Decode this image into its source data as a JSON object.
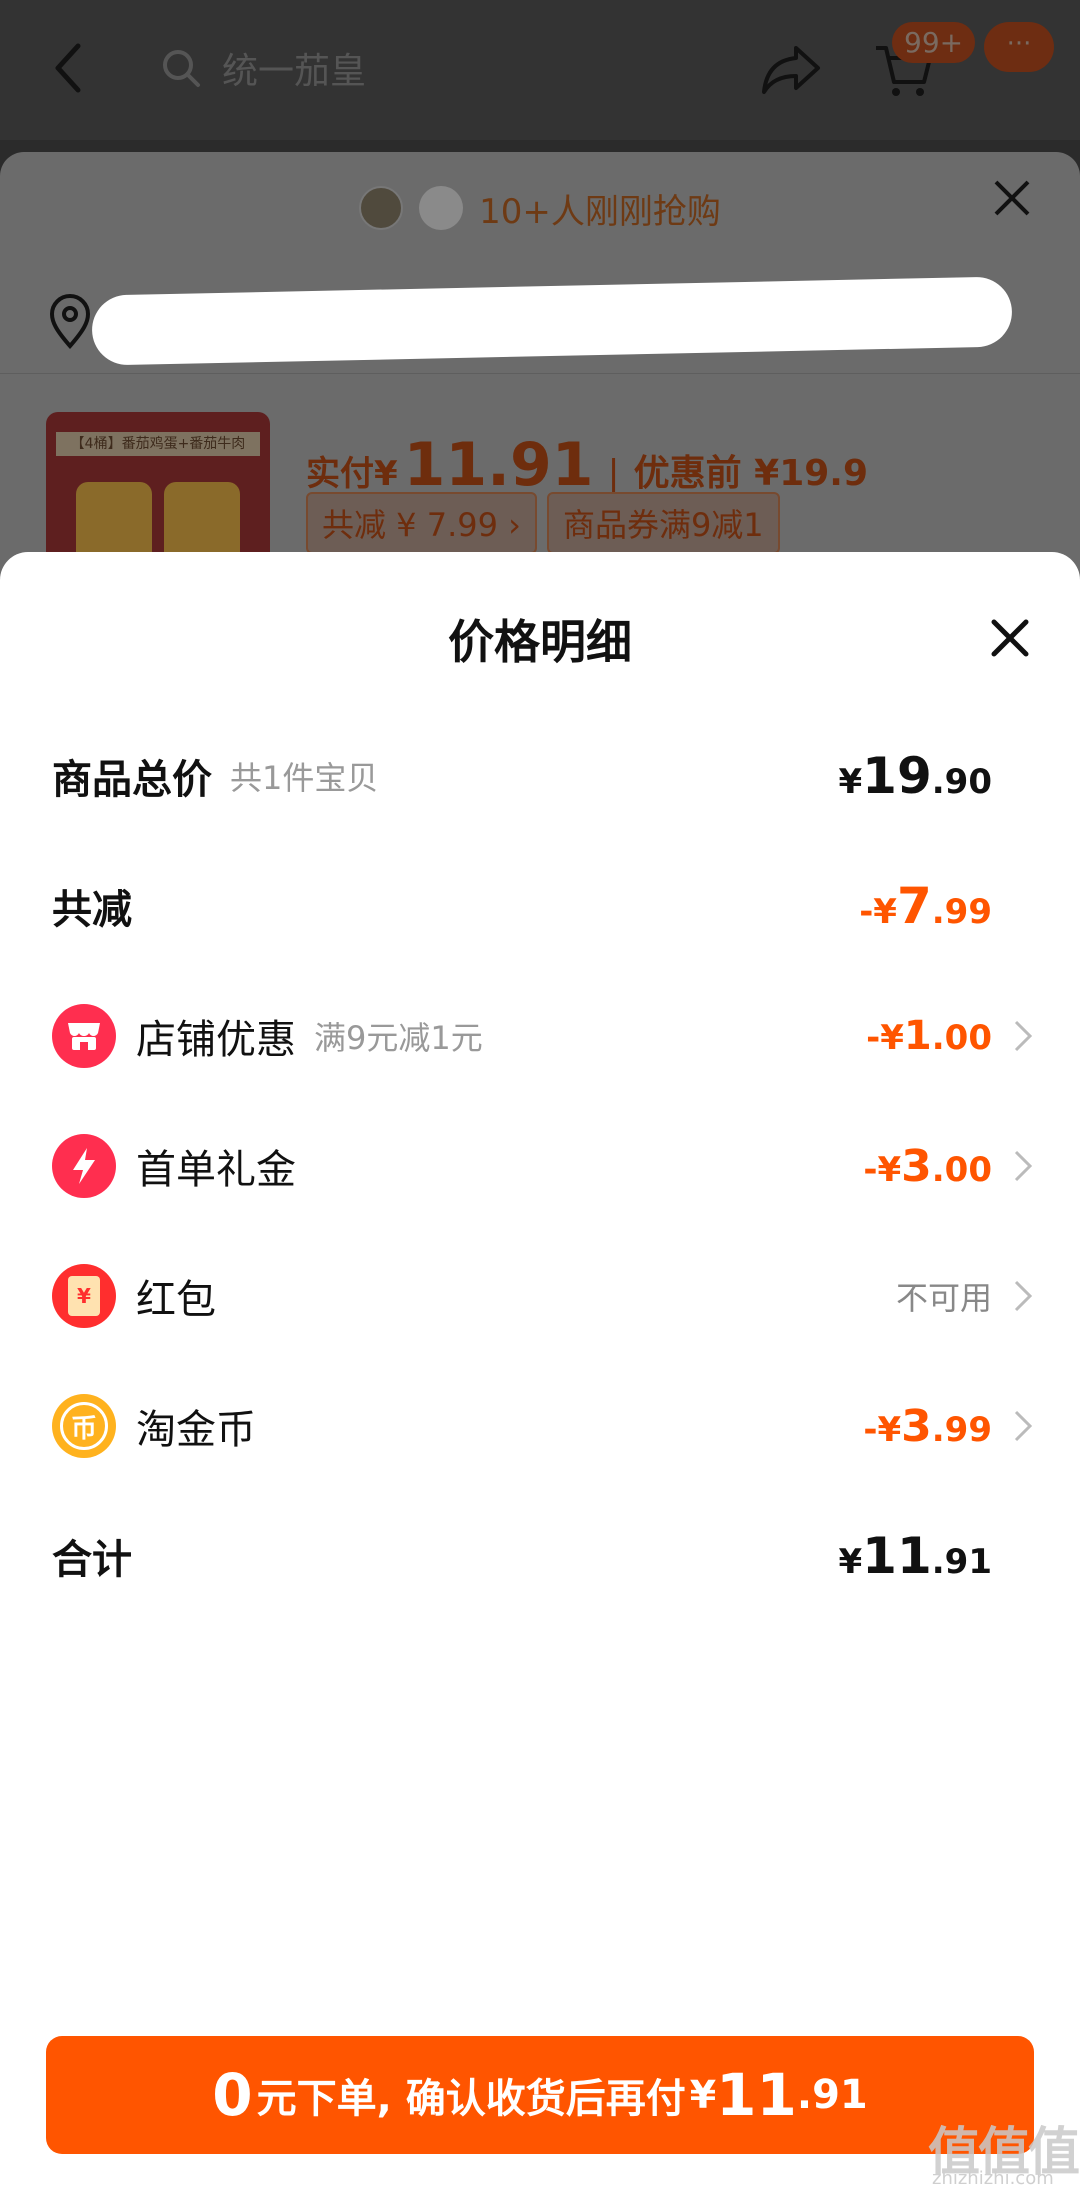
{
  "topbar": {
    "search_placeholder": "统一茄皇",
    "cart_badge": "99+",
    "more_badge": "···"
  },
  "underlay": {
    "recent_buyers": "10+人刚刚抢购",
    "product_thumb_label": "【4桶】番茄鸡蛋+番茄牛肉",
    "actual_pay_label": "实付",
    "actual_pay_yen": "¥",
    "actual_pay_amount": "11.91",
    "separator": "|",
    "before_discount": "优惠前 ¥19.9",
    "tag_total_discount": "共减 ¥ 7.99 ›",
    "tag_coupon": "商品券满9减1"
  },
  "sheet": {
    "title": "价格明细",
    "rows": [
      {
        "label": "商品总价",
        "sub": "共1件宝贝",
        "yen": "¥",
        "int": "19",
        "dec": ".90"
      },
      {
        "label": "共减",
        "yen": "-¥",
        "int": "7",
        "dec": ".99"
      },
      {
        "label": "店铺优惠",
        "sub": "满9元减1元",
        "yen": "-¥",
        "int": "1",
        "dec": ".00"
      },
      {
        "label": "首单礼金",
        "yen": "-¥",
        "int": "3",
        "dec": ".00"
      },
      {
        "label": "红包",
        "status": "不可用"
      },
      {
        "label": "淘金币",
        "yen": "-¥",
        "int": "3",
        "dec": ".99"
      },
      {
        "label": "合计",
        "yen": "¥",
        "int": "11",
        "dec": ".91"
      }
    ],
    "icons": {
      "shop": "shop-icon",
      "gift": "lightning-icon",
      "redpacket": "red-packet-icon",
      "coin": "coin-icon"
    },
    "icon_glyphs": {
      "redpacket": "¥",
      "coin": "币"
    }
  },
  "cta": {
    "zero": "0",
    "text": "元下单, 确认收货后再付",
    "yen": "¥",
    "int": "11",
    "dec": ".91"
  },
  "watermark": {
    "text": "值值值",
    "url": "zhizhizhi.com"
  },
  "colors": {
    "accent": "#ff5500",
    "text": "#111111",
    "muted": "#999999"
  }
}
